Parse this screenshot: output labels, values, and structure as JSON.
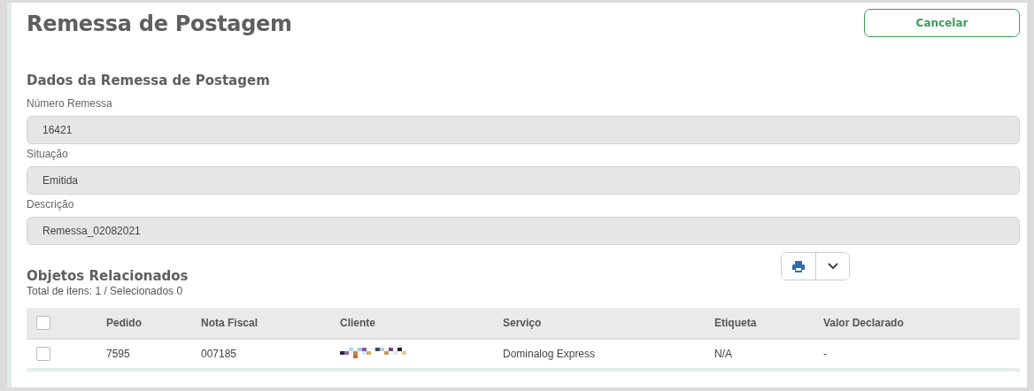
{
  "title": "Remessa de Postagem",
  "cancel_button": "Cancelar",
  "section_title": "Dados da Remessa de Postagem",
  "fields": [
    {
      "label": "Número Remessa",
      "value": "16421"
    },
    {
      "label": "Situação",
      "value": "Emitida"
    },
    {
      "label": "Descrição",
      "value": "Remessa_02082021"
    }
  ],
  "objects": {
    "title": "Objetos Relacionados",
    "summary": "Total de itens: 1 / Selecionados 0",
    "select_all_checked": false,
    "columns": [
      "Pedido",
      "Nota Fiscal",
      "Cliente",
      "Serviço",
      "Etiqueta",
      "Valor Declarado"
    ],
    "rows": [
      {
        "checked": false,
        "cells": [
          "7595",
          "007185",
          {
            "kind": "redacted"
          },
          "Dominalog Express",
          "N/A",
          "-"
        ]
      }
    ]
  }
}
